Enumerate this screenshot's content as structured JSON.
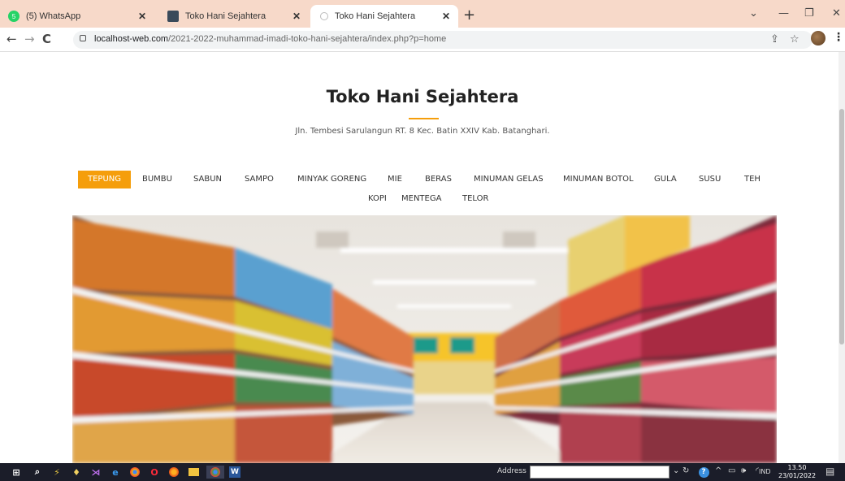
{
  "browser": {
    "tabs": [
      {
        "label": "(5) WhatsApp",
        "icon": "whatsapp-icon"
      },
      {
        "label": "Toko Hani Sejahtera",
        "icon": "site-icon"
      },
      {
        "label": "Toko Hani Sejahtera",
        "icon": "loading-icon"
      }
    ],
    "url_host": "localhost-web.com",
    "url_path": "/2021-2022-muhammad-imadi-toko-hani-sejahtera/index.php?p=home"
  },
  "site": {
    "title": "Toko Hani Sejahtera",
    "address": "Jln. Tembesi Sarulangun RT. 8 Kec. Batin XXIV Kab. Batanghari.",
    "accent": "#f59e0b"
  },
  "nav": {
    "items": [
      "TEPUNG",
      "BUMBU",
      "SABUN",
      "SAMPO",
      "MINYAK GORENG",
      "MIE",
      "BERAS",
      "MINUMAN GELAS",
      "MINUMAN BOTOL",
      "GULA",
      "SUSU",
      "TEH",
      "KOPI",
      "MENTEGA",
      "TELOR"
    ],
    "active": "TEPUNG"
  },
  "taskbar": {
    "address_label": "Address",
    "lang": "IND",
    "time": "13.50",
    "date": "23/01/2022"
  }
}
